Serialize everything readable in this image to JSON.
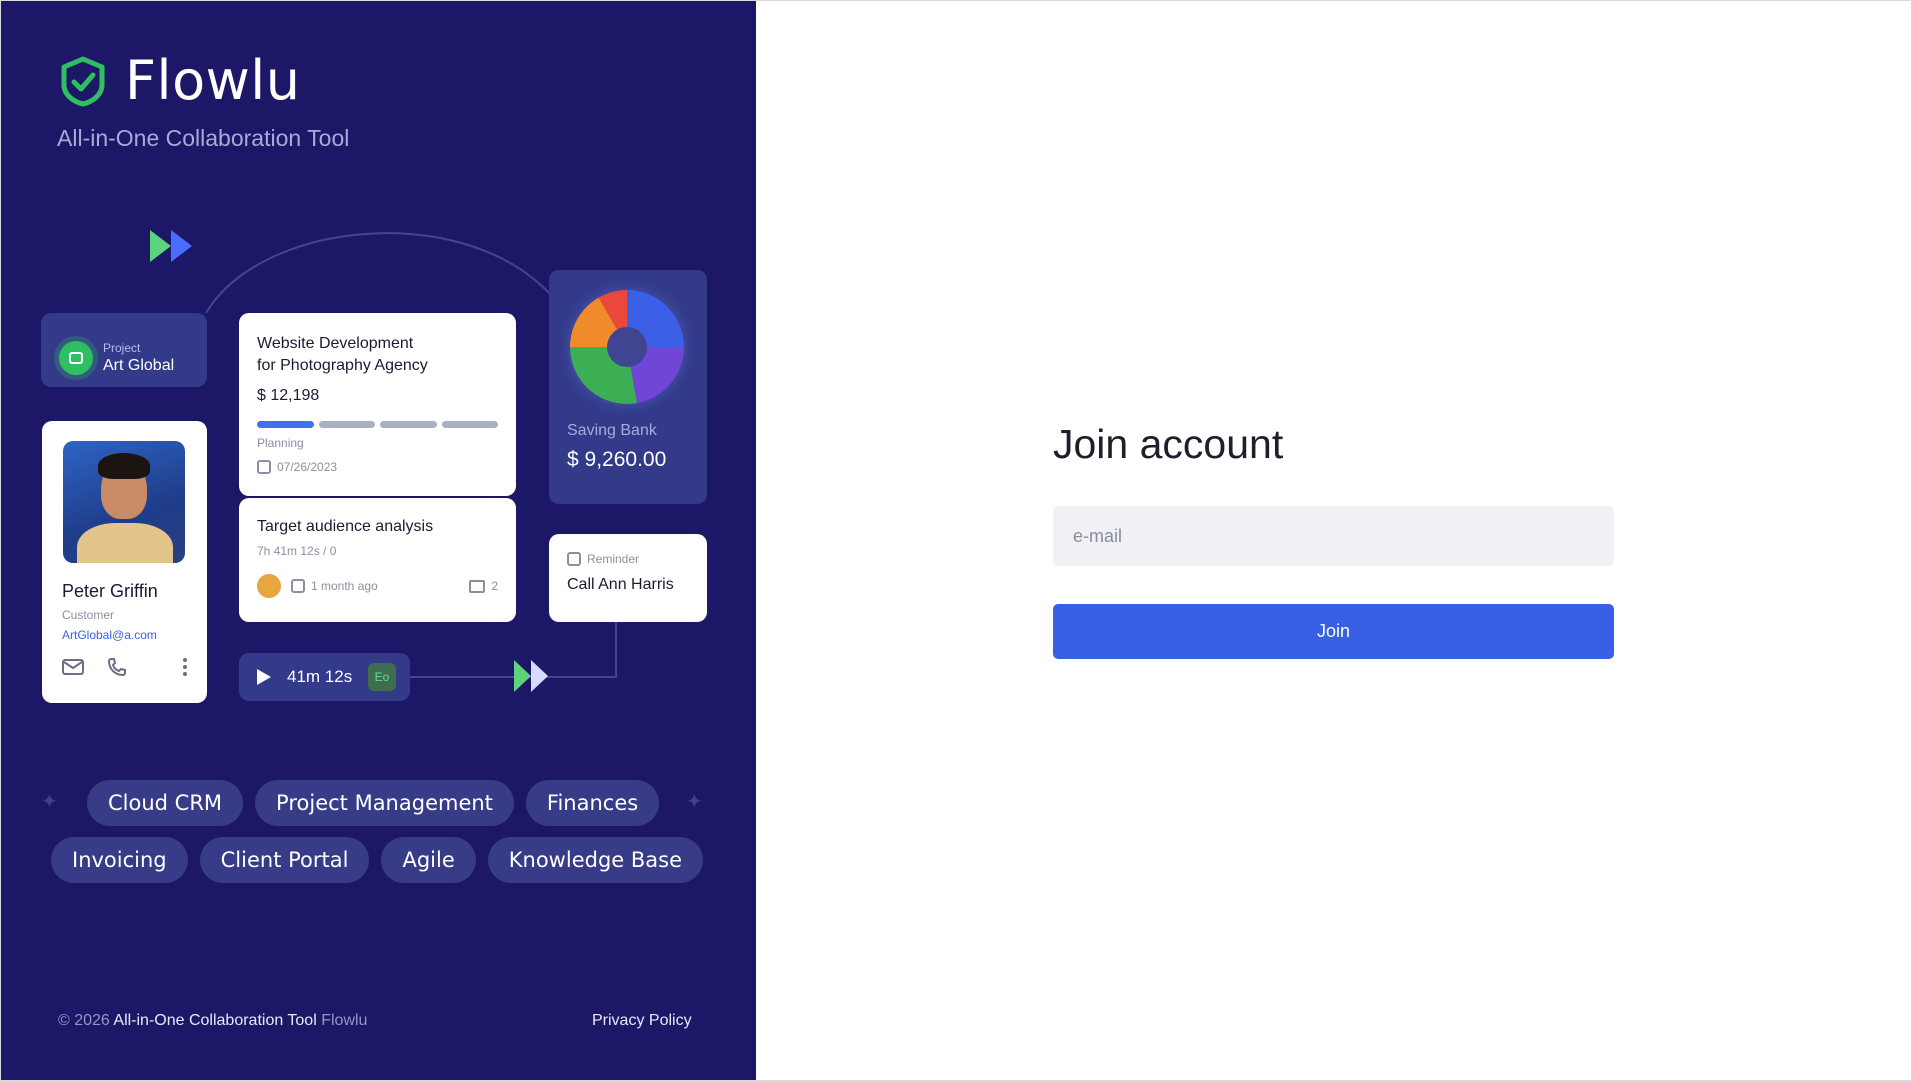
{
  "brand": {
    "name": "Flowlu",
    "tagline": "All-in-One Collaboration Tool",
    "accent": "#2fbf62",
    "panel_bg": "#1d1767"
  },
  "illustration": {
    "project": {
      "label": "Project",
      "name": "Art Global"
    },
    "person": {
      "name": "Peter Griffin",
      "role": "Customer",
      "email": "ArtGlobal@a.com"
    },
    "deal": {
      "title_line1": "Website Development",
      "title_line2": "for Photography Agency",
      "amount": "$ 12,198",
      "stage": "Planning",
      "date": "07/26/2023",
      "progress_segments_done": 1,
      "progress_segments_total": 4
    },
    "task": {
      "title": "Target audience analysis",
      "time": "7h 41m 12s / 0",
      "updated": "1 month ago",
      "comments": "2"
    },
    "bank": {
      "label": "Saving Bank",
      "value": "$ 9,260.00"
    },
    "reminder": {
      "label": "Reminder",
      "text": "Call Ann Harris"
    },
    "timer": {
      "time": "41m 12s",
      "badge": "Eo"
    }
  },
  "tags": {
    "row1": [
      "Cloud CRM",
      "Project Management",
      "Finances"
    ],
    "row2": [
      "Invoicing",
      "Client Portal",
      "Agile",
      "Knowledge Base"
    ]
  },
  "footer": {
    "copyright": "© 2026",
    "product": "All-in-One Collaboration Tool",
    "brand": "Flowlu",
    "privacy": "Privacy Policy"
  },
  "form": {
    "title": "Join account",
    "email_placeholder": "e-mail",
    "email_value": "",
    "submit_label": "Join",
    "submit_color": "#3760e6"
  }
}
